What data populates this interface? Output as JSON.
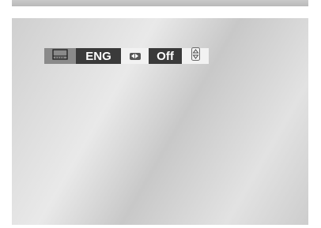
{
  "subtitle_osd": {
    "icon": "subtitle-icon",
    "language": "ENG",
    "language_nav_icon": "left-right-arrows-icon",
    "state": "Off",
    "state_nav_icon": "up-down-arrows-icon"
  },
  "colors": {
    "bar_dark": "#3a3a3a",
    "bar_mid": "#8a8a8a",
    "bar_light": "#f2f2f2",
    "text": "#ffffff"
  }
}
